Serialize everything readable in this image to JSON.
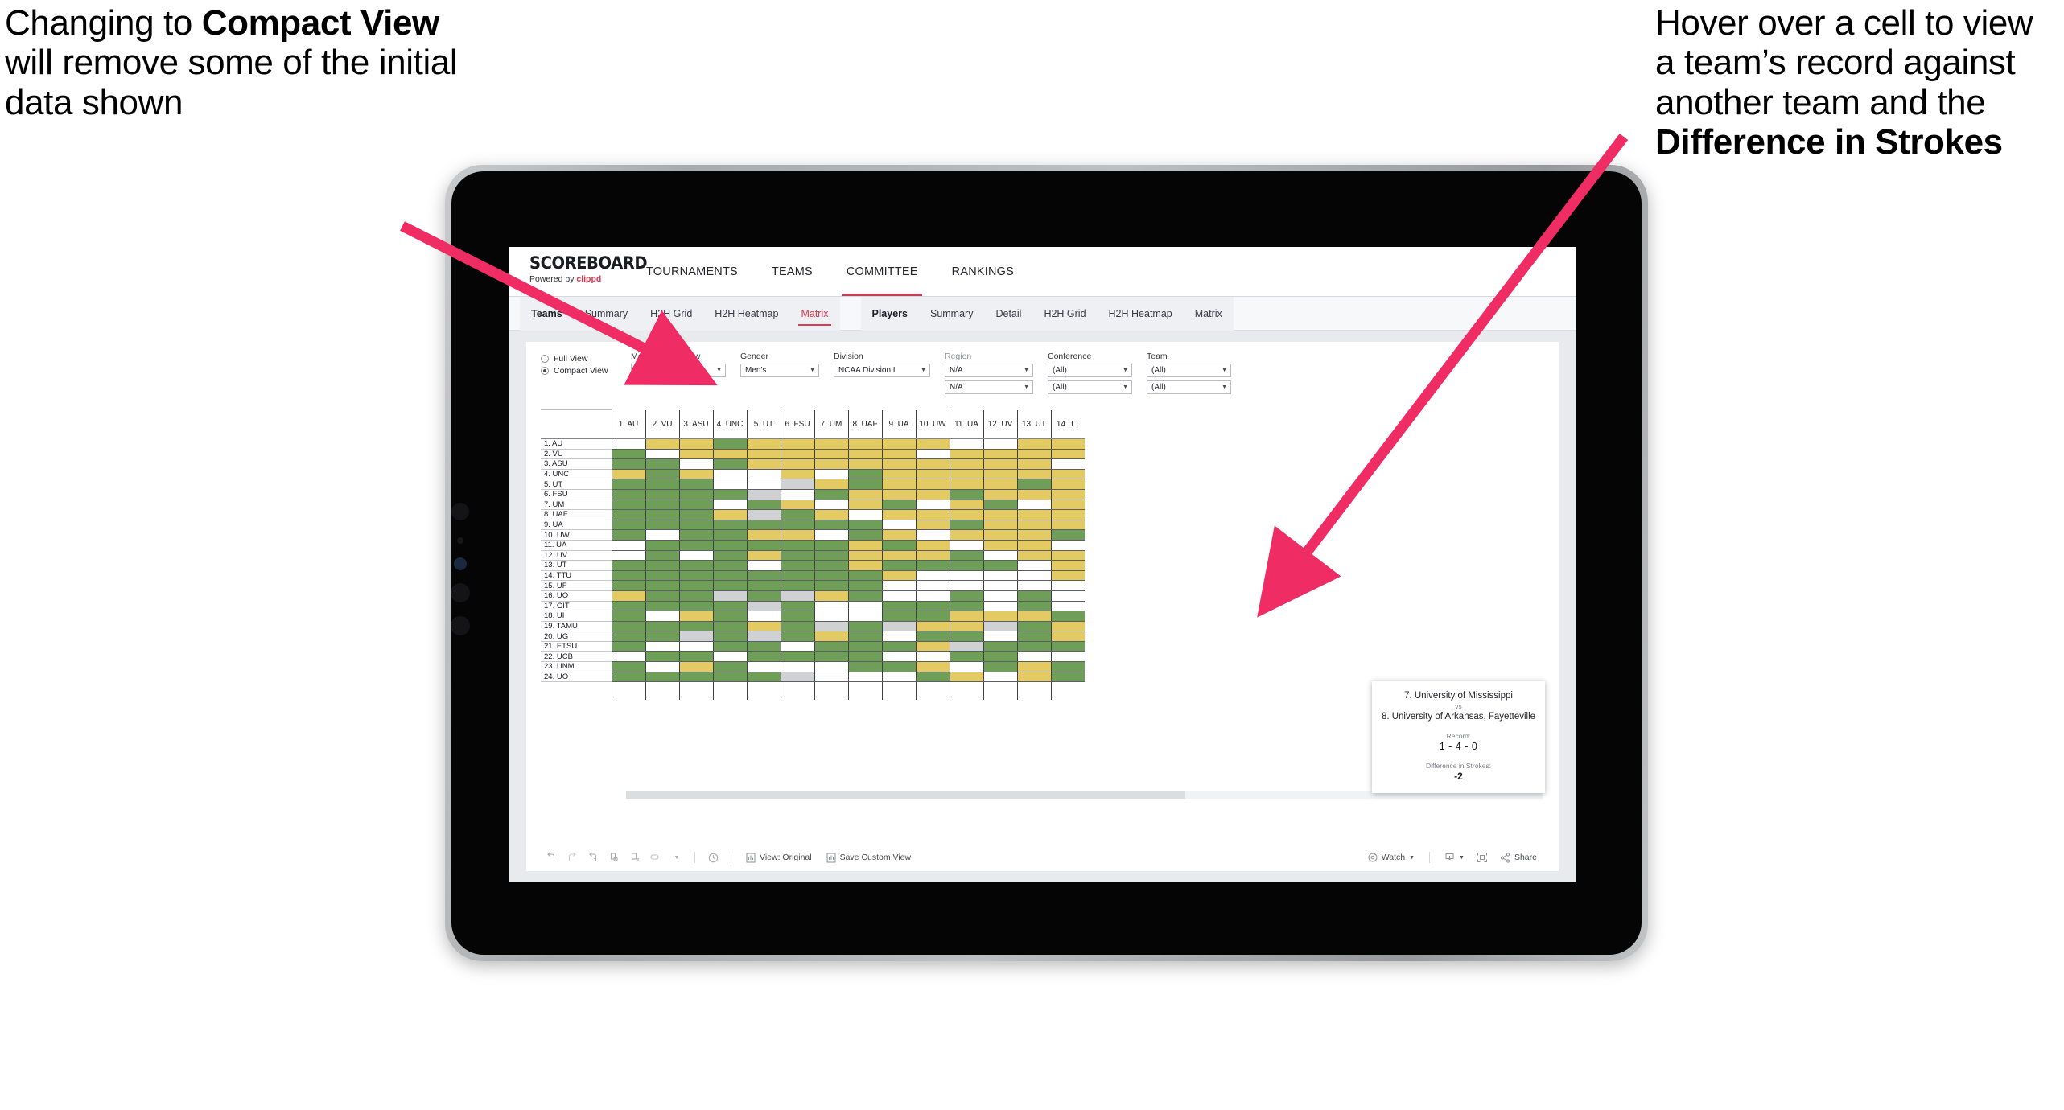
{
  "annotations": {
    "left": {
      "pre": "Changing to ",
      "bold": "Compact View",
      "post": " will remove some of the initial data shown"
    },
    "right": {
      "pre": "Hover over a cell to view a team’s record against another team and the ",
      "bold": "Difference in Strokes",
      "post": ""
    },
    "arrow_color": "#ef2d64"
  },
  "app": {
    "brand": {
      "title": "SCOREBOARD",
      "powered_prefix": "Powered by ",
      "powered_name": "clippd"
    },
    "topnav": [
      {
        "label": "TOURNAMENTS",
        "active": false
      },
      {
        "label": "TEAMS",
        "active": false
      },
      {
        "label": "COMMITTEE",
        "active": true
      },
      {
        "label": "RANKINGS",
        "active": false
      }
    ],
    "subnav_teams": [
      {
        "label": "Teams",
        "head": true,
        "selected": false
      },
      {
        "label": "Summary",
        "head": false,
        "selected": false
      },
      {
        "label": "H2H Grid",
        "head": false,
        "selected": false
      },
      {
        "label": "H2H Heatmap",
        "head": false,
        "selected": false
      },
      {
        "label": "Matrix",
        "head": false,
        "selected": true
      }
    ],
    "subnav_players": [
      {
        "label": "Players",
        "head": true,
        "selected": false
      },
      {
        "label": "Summary",
        "head": false,
        "selected": false
      },
      {
        "label": "Detail",
        "head": false,
        "selected": false
      },
      {
        "label": "H2H Grid",
        "head": false,
        "selected": false
      },
      {
        "label": "H2H Heatmap",
        "head": false,
        "selected": false
      },
      {
        "label": "Matrix",
        "head": false,
        "selected": false
      }
    ]
  },
  "filters": {
    "view_modes": [
      {
        "label": "Full View",
        "selected": false
      },
      {
        "label": "Compact View",
        "selected": true
      }
    ],
    "groups": [
      {
        "label": "Max teams in view",
        "muted": false,
        "values": [
          "Top 50"
        ]
      },
      {
        "label": "Gender",
        "muted": false,
        "values": [
          "Men's"
        ]
      },
      {
        "label": "Division",
        "muted": false,
        "values": [
          "NCAA Division I"
        ]
      },
      {
        "label": "Region",
        "muted": true,
        "values": [
          "N/A",
          "N/A"
        ]
      },
      {
        "label": "Conference",
        "muted": false,
        "values": [
          "(All)",
          "(All)"
        ]
      },
      {
        "label": "Team",
        "muted": false,
        "values": [
          "(All)",
          "(All)"
        ]
      }
    ]
  },
  "matrix": {
    "columns": [
      "1. AU",
      "2. VU",
      "3. ASU",
      "4. UNC",
      "5. UT",
      "6. FSU",
      "7. UM",
      "8. UAF",
      "9. UA",
      "10. UW",
      "11. UA",
      "12. UV",
      "13. UT",
      "14. TT"
    ],
    "rows": [
      "1. AU",
      "2. VU",
      "3. ASU",
      "4. UNC",
      "5. UT",
      "6. FSU",
      "7. UM",
      "8. UAF",
      "9. UA",
      "10. UW",
      "11. UA",
      "12. UV",
      "13. UT",
      "14. TTU",
      "15. UF",
      "16. UO",
      "17. GIT",
      "18. UI",
      "19. TAMU",
      "20. UG",
      "21. ETSU",
      "22. UCB",
      "23. UNM",
      "24. UO"
    ],
    "legend": {
      "win": "#6f9e59",
      "loss": "#e3ca63",
      "tie": "#d0d1d3",
      "none": "#ffffff"
    },
    "cells": [
      [
        "n",
        "y",
        "y",
        "g",
        "y",
        "y",
        "y",
        "y",
        "y",
        "y",
        "n",
        "n",
        "y",
        "y"
      ],
      [
        "g",
        "n",
        "y",
        "y",
        "y",
        "y",
        "y",
        "y",
        "y",
        "n",
        "y",
        "y",
        "y",
        "y"
      ],
      [
        "g",
        "g",
        "n",
        "g",
        "y",
        "y",
        "y",
        "y",
        "y",
        "y",
        "y",
        "y",
        "y",
        "n"
      ],
      [
        "y",
        "g",
        "y",
        "n",
        "n",
        "y",
        "n",
        "g",
        "y",
        "y",
        "y",
        "y",
        "y",
        "y"
      ],
      [
        "g",
        "g",
        "g",
        "n",
        "n",
        "s",
        "y",
        "g",
        "y",
        "y",
        "y",
        "y",
        "g",
        "y"
      ],
      [
        "g",
        "g",
        "g",
        "g",
        "s",
        "n",
        "g",
        "y",
        "y",
        "y",
        "g",
        "y",
        "y",
        "y"
      ],
      [
        "g",
        "g",
        "g",
        "n",
        "g",
        "y",
        "n",
        "y",
        "g",
        "n",
        "y",
        "g",
        "n",
        "y"
      ],
      [
        "g",
        "g",
        "g",
        "y",
        "s",
        "g",
        "y",
        "n",
        "y",
        "y",
        "y",
        "y",
        "y",
        "y"
      ],
      [
        "g",
        "g",
        "g",
        "g",
        "g",
        "g",
        "g",
        "g",
        "n",
        "y",
        "g",
        "y",
        "y",
        "y"
      ],
      [
        "g",
        "n",
        "g",
        "g",
        "y",
        "y",
        "n",
        "g",
        "y",
        "n",
        "y",
        "y",
        "y",
        "g"
      ],
      [
        "n",
        "g",
        "g",
        "g",
        "g",
        "g",
        "g",
        "y",
        "g",
        "y",
        "n",
        "y",
        "y",
        "n"
      ],
      [
        "n",
        "g",
        "n",
        "g",
        "y",
        "g",
        "g",
        "y",
        "y",
        "y",
        "g",
        "n",
        "y",
        "y"
      ],
      [
        "g",
        "g",
        "g",
        "g",
        "n",
        "g",
        "g",
        "y",
        "g",
        "g",
        "g",
        "g",
        "n",
        "y"
      ],
      [
        "g",
        "g",
        "g",
        "g",
        "g",
        "g",
        "g",
        "g",
        "y",
        "n",
        "n",
        "n",
        "n",
        "y"
      ],
      [
        "g",
        "g",
        "g",
        "g",
        "g",
        "g",
        "g",
        "g",
        "n",
        "n",
        "n",
        "n",
        "n",
        "n"
      ],
      [
        "y",
        "g",
        "g",
        "s",
        "g",
        "s",
        "y",
        "g",
        "n",
        "n",
        "g",
        "n",
        "g",
        "n"
      ],
      [
        "g",
        "g",
        "g",
        "g",
        "s",
        "g",
        "n",
        "n",
        "g",
        "g",
        "g",
        "n",
        "g",
        "n"
      ],
      [
        "g",
        "n",
        "y",
        "g",
        "n",
        "g",
        "n",
        "n",
        "g",
        "g",
        "y",
        "y",
        "y",
        "g"
      ],
      [
        "g",
        "g",
        "g",
        "g",
        "y",
        "g",
        "s",
        "g",
        "s",
        "y",
        "y",
        "s",
        "g",
        "y"
      ],
      [
        "g",
        "g",
        "s",
        "g",
        "s",
        "g",
        "y",
        "g",
        "n",
        "g",
        "g",
        "n",
        "g",
        "y"
      ],
      [
        "g",
        "n",
        "n",
        "g",
        "g",
        "n",
        "g",
        "g",
        "g",
        "y",
        "s",
        "g",
        "g",
        "g"
      ],
      [
        "n",
        "g",
        "g",
        "n",
        "g",
        "g",
        "g",
        "g",
        "n",
        "n",
        "g",
        "g",
        "n",
        "n"
      ],
      [
        "g",
        "n",
        "y",
        "g",
        "n",
        "n",
        "n",
        "g",
        "g",
        "y",
        "n",
        "g",
        "y",
        "g"
      ],
      [
        "g",
        "g",
        "g",
        "g",
        "g",
        "s",
        "n",
        "n",
        "n",
        "g",
        "y",
        "n",
        "y",
        "g"
      ]
    ]
  },
  "tooltip": {
    "team_a": "7. University of Mississippi",
    "vs": "vs",
    "team_b": "8. University of Arkansas, Fayetteville",
    "record_label": "Record:",
    "record_value": "1 - 4 - 0",
    "diff_label": "Difference in Strokes:",
    "diff_value": "-2"
  },
  "toolbar": {
    "view_label": "View: Original",
    "save_label": "Save Custom View",
    "watch_label": "Watch",
    "share_label": "Share"
  }
}
